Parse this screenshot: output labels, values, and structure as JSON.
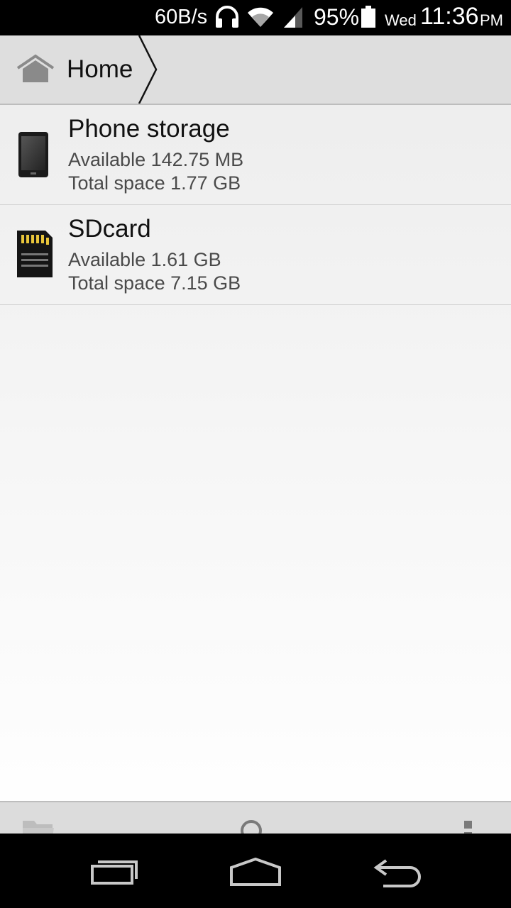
{
  "status_bar": {
    "net_speed": "60B/s",
    "battery_percent": "95%",
    "day": "Wed",
    "time": "11:36",
    "ampm": "PM",
    "icons": [
      "headphones-icon",
      "wifi-icon",
      "signal-icon",
      "battery-icon"
    ]
  },
  "breadcrumb": {
    "home_label": "Home"
  },
  "storage_list": [
    {
      "name": "Phone storage",
      "available": "Available 142.75 MB",
      "total": "Total space 1.77 GB",
      "icon": "phone-storage-icon"
    },
    {
      "name": "SDcard",
      "available": "Available 1.61 GB",
      "total": "Total space 7.15 GB",
      "icon": "sdcard-icon"
    }
  ],
  "action_bar": {
    "icons": [
      "new-folder-icon",
      "search-icon",
      "overflow-menu-icon"
    ]
  },
  "nav_bar": {
    "icons": [
      "recent-apps-icon",
      "home-icon",
      "back-icon"
    ]
  },
  "colors": {
    "breadcrumb_bg": "#dedede",
    "action_bar_bg": "#dcdcdc",
    "icon_gray": "#808080"
  }
}
